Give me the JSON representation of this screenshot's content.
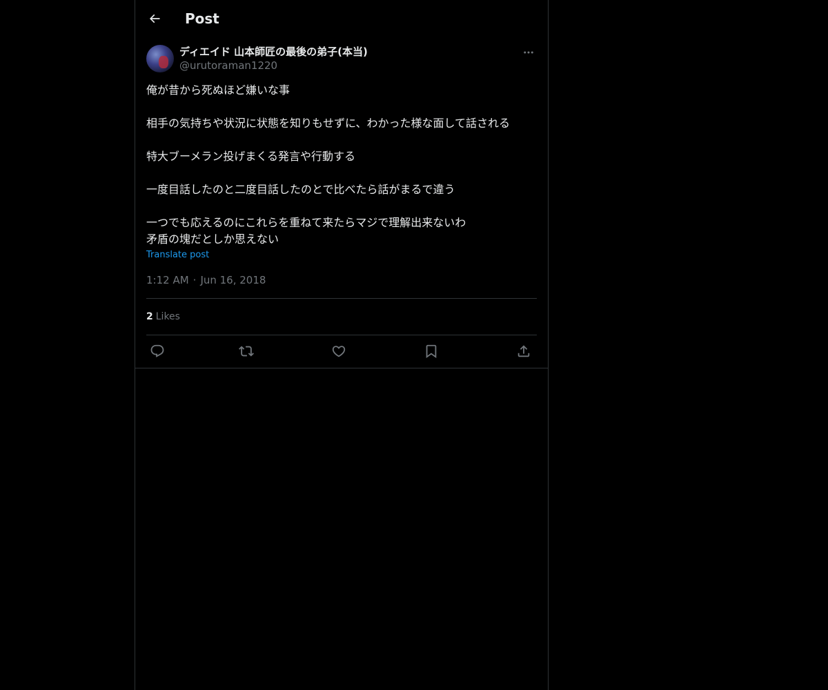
{
  "header": {
    "title": "Post",
    "back_icon": "arrow-left-icon"
  },
  "post": {
    "author": {
      "display_name": "ディエイド 山本師匠の最後の弟子(本当)",
      "handle": "@urutoraman1220"
    },
    "text": "俺が昔から死ぬほど嫌いな事\n\n相手の気持ちや状況に状態を知りもせずに、わかった様な面して話される\n\n特大ブーメラン投げまくる発言や行動する\n\n一度目話したのと二度目話したのとで比べたら話がまるで違う\n\n一つでも応えるのにこれらを重ねて来たらマジで理解出来ないわ\n矛盾の塊だとしか思えない",
    "translate_label": "Translate post",
    "time": "1:12 AM",
    "separator": "·",
    "date": "Jun 16, 2018",
    "likes_count": "2",
    "likes_label": "Likes"
  },
  "actions": {
    "reply_icon": "reply-icon",
    "repost_icon": "repost-icon",
    "like_icon": "heart-icon",
    "bookmark_icon": "bookmark-icon",
    "share_icon": "share-icon"
  },
  "colors": {
    "background": "#000000",
    "text": "#e7e9ea",
    "muted": "#71767b",
    "link": "#1d9bf0",
    "border": "#2f3336"
  }
}
